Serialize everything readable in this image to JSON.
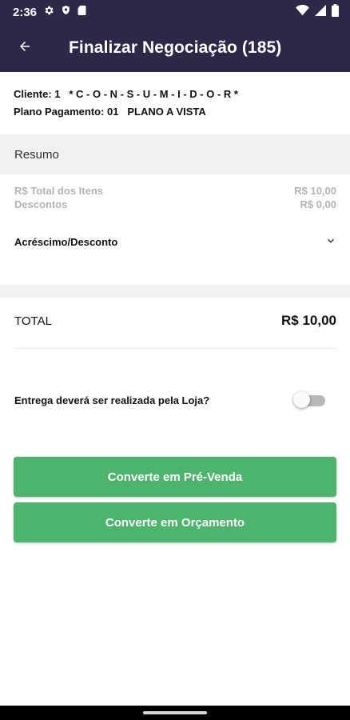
{
  "status_bar": {
    "time": "2:36",
    "left_icons": [
      "gear-icon",
      "shield-icon",
      "sim-card-icon"
    ],
    "right_icons": [
      "wifi-icon",
      "signal-icon",
      "battery-icon"
    ]
  },
  "app_bar": {
    "title": "Finalizar Negociação (185)",
    "back_icon": "arrow-left-icon"
  },
  "client": {
    "client_label": "Cliente: 1",
    "client_name": "* C - O - N - S - U - M - I - D - O - R *",
    "payment_label": "Plano Pagamento: 01",
    "payment_name": "PLANO A VISTA"
  },
  "summary": {
    "header": "Resumo",
    "items_label": "R$ Total dos Itens",
    "items_value": "R$ 10,00",
    "discounts_label": "Descontos",
    "discounts_value": "R$ 0,00",
    "adjustment_label": "Acréscimo/Desconto"
  },
  "total": {
    "label": "TOTAL",
    "value": "R$ 10,00"
  },
  "delivery": {
    "label": "Entrega deverá ser realizada pela Loja?",
    "enabled": false
  },
  "actions": {
    "pre_sale": "Converte em Pré-Venda",
    "quote": "Converte em Orçamento"
  },
  "colors": {
    "primary_dark": "#2e2747",
    "accent_green": "#4cb46c",
    "section_bg": "#f1f1f1",
    "muted_text": "#b4b4b4"
  }
}
